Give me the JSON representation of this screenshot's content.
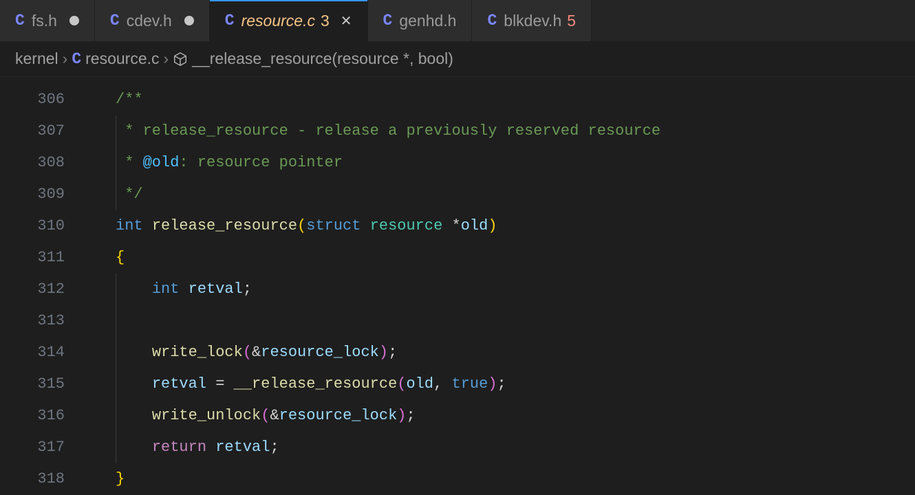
{
  "tabs": [
    {
      "icon": "C",
      "name": "fs.h",
      "modified": true,
      "active": false,
      "badge": "",
      "badgeClass": ""
    },
    {
      "icon": "C",
      "name": "cdev.h",
      "modified": true,
      "active": false,
      "badge": "",
      "badgeClass": ""
    },
    {
      "icon": "C",
      "name": "resource.c",
      "modified": false,
      "active": true,
      "badge": "3",
      "badgeClass": "badge-num"
    },
    {
      "icon": "C",
      "name": "genhd.h",
      "modified": false,
      "active": false,
      "badge": "",
      "badgeClass": ""
    },
    {
      "icon": "C",
      "name": "blkdev.h",
      "modified": false,
      "active": false,
      "badge": "5",
      "badgeClass": "badge-num-red"
    }
  ],
  "breadcrumb": {
    "folder": "kernel",
    "fileIcon": "C",
    "file": "resource.c",
    "symbol": "__release_resource(resource *, bool)"
  },
  "gutter": [
    "306",
    "307",
    "308",
    "309",
    "310",
    "311",
    "312",
    "313",
    "314",
    "315",
    "316",
    "317",
    "318"
  ],
  "code": {
    "l306": "/**",
    "l307a": " * release_resource - release a previously reserved resource",
    "l308a": " * ",
    "l308b": "@old",
    "l308c": ": resource pointer",
    "l309": " */",
    "l310_int": "int",
    "l310_fn": "release_resource",
    "l310_struct": "struct",
    "l310_type": "resource",
    "l310_arg": "old",
    "l311_brace": "{",
    "l312_int": "int",
    "l312_var": "retval",
    "l312_semi": ";",
    "l314_fn": "write_lock",
    "l314_amp": "&",
    "l314_arg": "resource_lock",
    "l315_var": "retval",
    "l315_eq": " = ",
    "l315_fn": "__release_resource",
    "l315_arg1": "old",
    "l315_comma": ", ",
    "l315_arg2": "true",
    "l316_fn": "write_unlock",
    "l316_amp": "&",
    "l316_arg": "resource_lock",
    "l317_ret": "return",
    "l317_var": "retval",
    "l318_brace": "}"
  }
}
